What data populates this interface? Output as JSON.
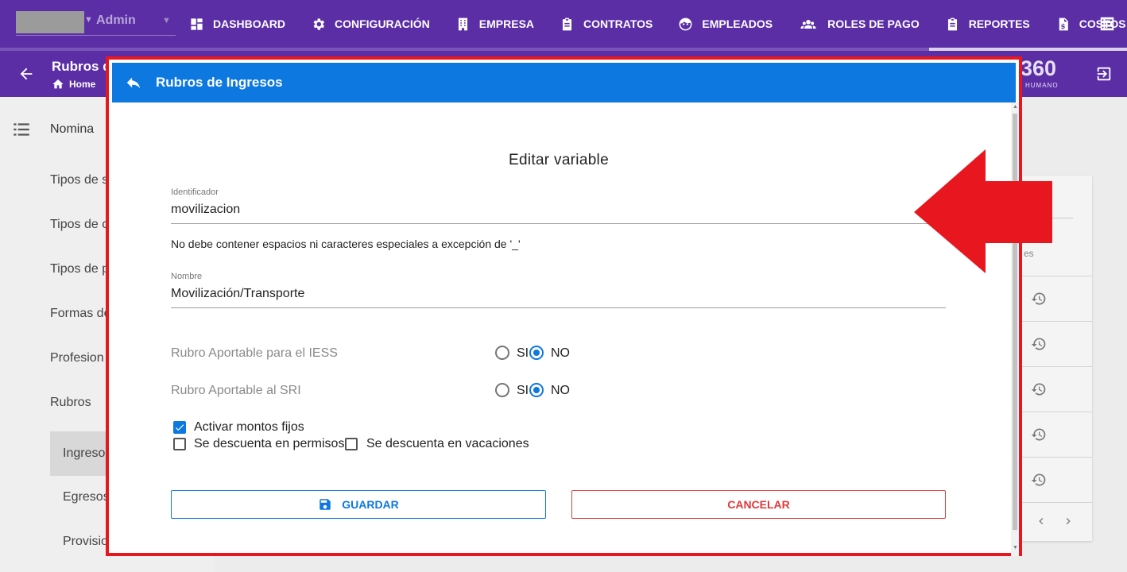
{
  "topbar": {
    "user_name": "Admin",
    "nav": [
      {
        "label": "DASHBOARD",
        "icon": "dashboard-icon"
      },
      {
        "label": "CONFIGURACIÓN",
        "icon": "gear-icon"
      },
      {
        "label": "EMPRESA",
        "icon": "building-icon"
      },
      {
        "label": "CONTRATOS",
        "icon": "clipboard-icon"
      },
      {
        "label": "EMPLEADOS",
        "icon": "face-icon"
      },
      {
        "label": "ROLES DE PAGO",
        "icon": "people-icon"
      },
      {
        "label": "REPORTES",
        "icon": "clipboard-icon"
      },
      {
        "label": "COSTOS",
        "icon": "dollar-file-icon"
      }
    ]
  },
  "pagehead": {
    "title": "Rubros d",
    "breadcrumb": "Home",
    "brand": "360",
    "brand_sub": "HUMANO"
  },
  "sidebar": {
    "title": "Nomina",
    "items": [
      "Tipos de s",
      "Tipos de c",
      "Tipos de p",
      "Formas de",
      "Profesion",
      "Rubros"
    ],
    "subitems": [
      "Ingreso",
      "Egresos",
      "Provisio"
    ]
  },
  "background": {
    "column_text": "es"
  },
  "dialog": {
    "title": "Rubros de Ingresos",
    "form_title": "Editar variable",
    "identifier": {
      "label": "Identificador",
      "value": "movilizacion",
      "hint": "No debe contener espacios ni caracteres especiales a excepción de '_'"
    },
    "name": {
      "label": "Nombre",
      "value": "Movilización/Transporte"
    },
    "radio_groups": [
      {
        "label": "Rubro Aportable para el IESS",
        "options": [
          "SI",
          "NO"
        ],
        "selected": "NO"
      },
      {
        "label": "Rubro Aportable al SRI",
        "options": [
          "SI",
          "NO"
        ],
        "selected": "NO"
      }
    ],
    "checkboxes": [
      {
        "label": "Activar montos fijos",
        "checked": true
      },
      {
        "label": "Se descuenta en permisos",
        "checked": false
      },
      {
        "label": "Se descuenta en vacaciones",
        "checked": false
      }
    ],
    "buttons": {
      "save": "GUARDAR",
      "cancel": "CANCELAR"
    }
  },
  "colors": {
    "primary_purple": "#5b2ea6",
    "dialog_blue": "#0c78e0",
    "annotation_red": "#e8161f",
    "cancel_red": "#e03a3a"
  }
}
